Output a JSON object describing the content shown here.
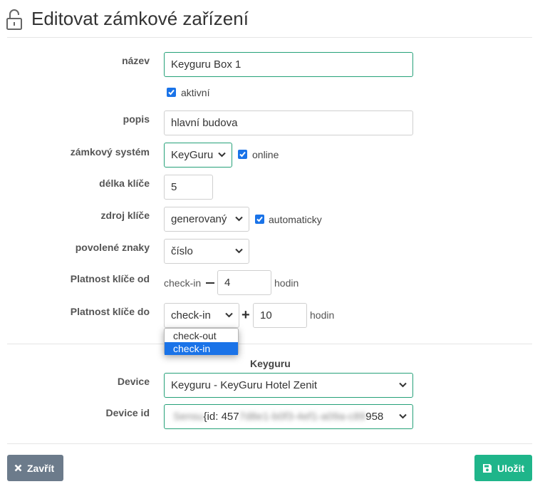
{
  "header": {
    "title": "Editovat zámkové zařízení",
    "icon": "unlock-icon"
  },
  "form": {
    "name": {
      "label": "název",
      "value": "Keyguru Box 1"
    },
    "active": {
      "label": "aktivní",
      "checked": true
    },
    "description": {
      "label": "popis",
      "value": "hlavní budova"
    },
    "lock_system": {
      "label": "zámkový systém",
      "value": "KeyGuru",
      "online_label": "online",
      "online_checked": true
    },
    "key_length": {
      "label": "délka klíče",
      "value": "5"
    },
    "key_source": {
      "label": "zdroj klíče",
      "value": "generovaný",
      "auto_label": "automaticky",
      "auto_checked": true
    },
    "allowed_chars": {
      "label": "povolené znaky",
      "value": "číslo"
    },
    "valid_from": {
      "label": "Platnost klíče od",
      "base": "check-in",
      "hours": "4",
      "unit": "hodin"
    },
    "valid_to": {
      "label": "Platnost klíče do",
      "base": "check-in",
      "hours": "10",
      "unit": "hodin",
      "options": [
        "check-out",
        "check-in"
      ]
    }
  },
  "keyguru": {
    "section_title": "Keyguru",
    "device": {
      "label": "Device",
      "value": "Keyguru - KeyGuru Hotel Zenit"
    },
    "device_id": {
      "label": "Device id",
      "prefix": "Sensu",
      "value": "{id: 457",
      "masked": "7d8e1-b0f3-4ef1-a09a-c89",
      "suffix": "958"
    }
  },
  "footer": {
    "close_label": "Zavřít",
    "save_label": "Uložit"
  },
  "colors": {
    "accent_green": "#1fb58a",
    "focus_border": "#26a179",
    "checkbox_blue": "#1a73e8",
    "close_gray": "#6c7b8b"
  }
}
